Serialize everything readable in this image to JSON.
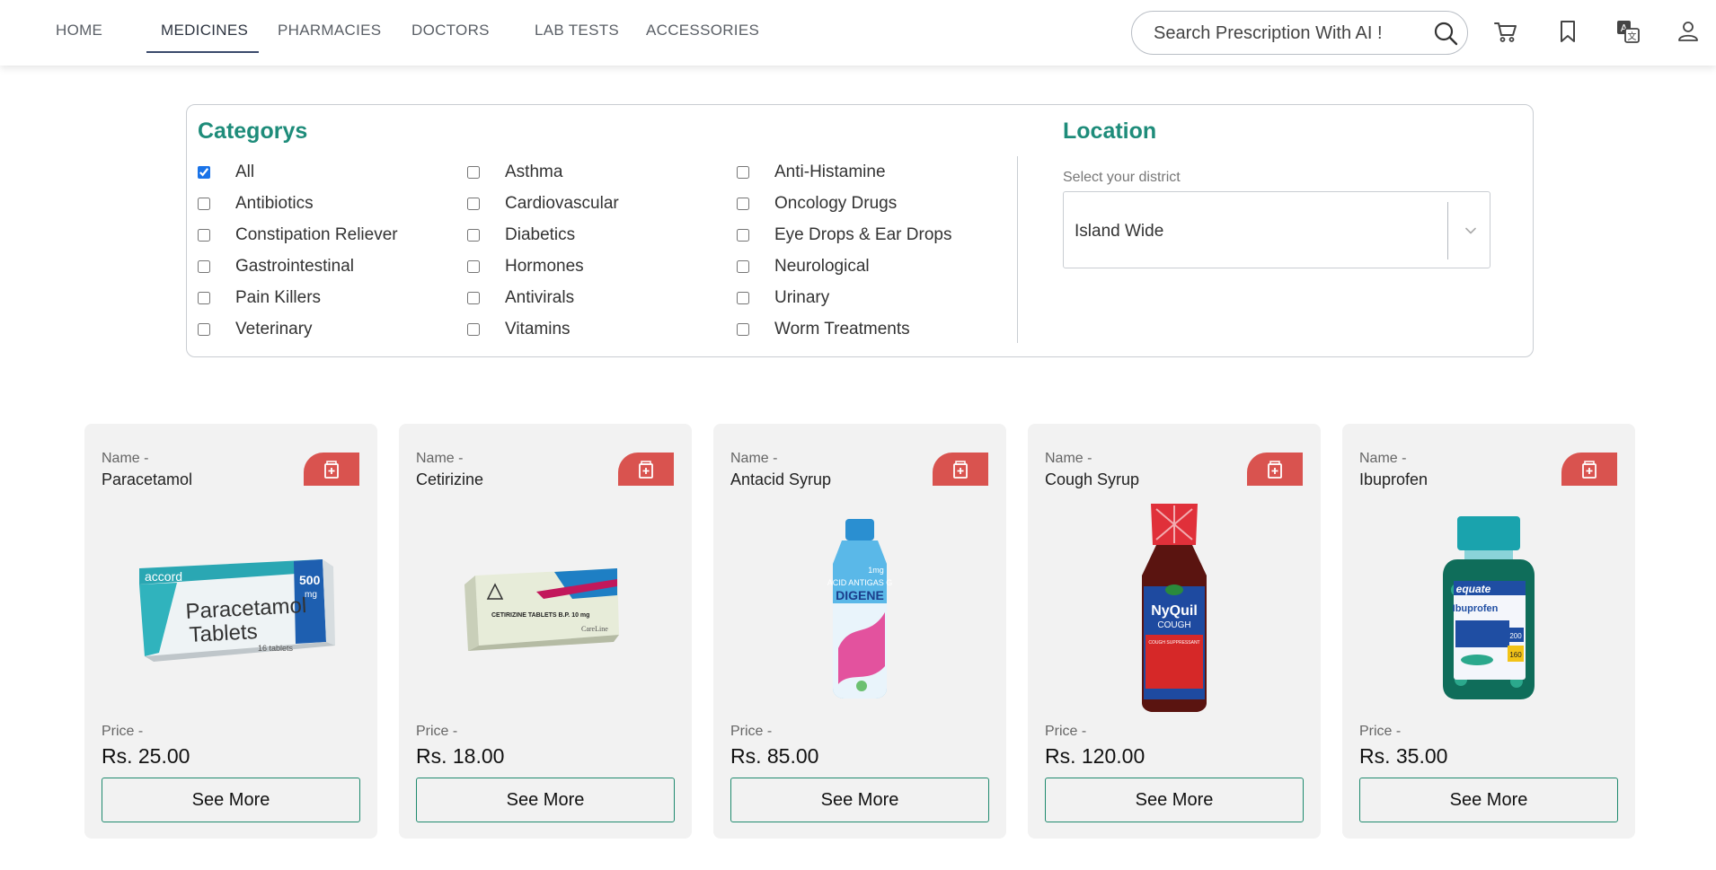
{
  "nav": {
    "links": [
      "HOME",
      "MEDICINES",
      "PHARMACIES",
      "DOCTORS",
      "LAB TESTS",
      "ACCESSORIES"
    ],
    "active": "MEDICINES",
    "search_placeholder": "Search Prescription With AI !"
  },
  "filters": {
    "categories_title": "Categorys",
    "categories": [
      {
        "label": "All",
        "checked": true
      },
      {
        "label": "Asthma",
        "checked": false
      },
      {
        "label": "Anti-Histamine",
        "checked": false
      },
      {
        "label": "Antibiotics",
        "checked": false
      },
      {
        "label": "Cardiovascular",
        "checked": false
      },
      {
        "label": "Oncology Drugs",
        "checked": false
      },
      {
        "label": "Constipation Reliever",
        "checked": false
      },
      {
        "label": "Diabetics",
        "checked": false
      },
      {
        "label": "Eye Drops & Ear Drops",
        "checked": false
      },
      {
        "label": "Gastrointestinal",
        "checked": false
      },
      {
        "label": "Hormones",
        "checked": false
      },
      {
        "label": "Neurological",
        "checked": false
      },
      {
        "label": "Pain Killers",
        "checked": false
      },
      {
        "label": "Antivirals",
        "checked": false
      },
      {
        "label": "Urinary",
        "checked": false
      },
      {
        "label": "Veterinary",
        "checked": false
      },
      {
        "label": "Vitamins",
        "checked": false
      },
      {
        "label": "Worm Treatments",
        "checked": false
      }
    ],
    "location_title": "Location",
    "district_label": "Select your district",
    "district_value": "Island Wide"
  },
  "products": [
    {
      "name_label": "Name -",
      "name": "Paracetamol",
      "price_label": "Price -",
      "price": "Rs. 25.00",
      "button": "See More"
    },
    {
      "name_label": "Name -",
      "name": "Cetirizine",
      "price_label": "Price -",
      "price": "Rs. 18.00",
      "button": "See More"
    },
    {
      "name_label": "Name -",
      "name": "Antacid Syrup",
      "price_label": "Price -",
      "price": "Rs. 85.00",
      "button": "See More"
    },
    {
      "name_label": "Name -",
      "name": "Cough Syrup",
      "price_label": "Price -",
      "price": "Rs. 120.00",
      "button": "See More"
    },
    {
      "name_label": "Name -",
      "name": "Ibuprofen",
      "price_label": "Price -",
      "price": "Rs. 35.00",
      "button": "See More"
    }
  ],
  "product_images": {
    "paracetamol": {
      "brand": "accord",
      "line1": "Paracetamol",
      "line2": "Tablets",
      "dose": "500",
      "unit": "mg",
      "count": "16 tablets"
    },
    "cetirizine": {
      "text": "CETIRIZINE TABLETS B.P. 10 mg",
      "maker": "CareLine"
    },
    "antacid": {
      "line1": "ACID ANTIGAS G",
      "brand": "DIGENE",
      "mg": "1mg"
    },
    "cough": {
      "brand": "NyQuil",
      "line": "COUGH",
      "sub": "COUGH SUPPRESSANT"
    },
    "ibuprofen": {
      "brand": "equate",
      "line": "Ibuprofen",
      "dose": "200",
      "count": "160"
    }
  },
  "colors": {
    "accent": "#1e8c7a",
    "button_border": "#1f8a6e",
    "tag": "#d9534f",
    "card_bg": "#f2f2f2",
    "nav_underline": "#3a4a6b"
  },
  "icons": [
    "search-icon",
    "cart-icon",
    "bookmark-icon",
    "translate-icon",
    "user-icon",
    "pharmacy-bag-icon",
    "chevron-down-icon"
  ]
}
